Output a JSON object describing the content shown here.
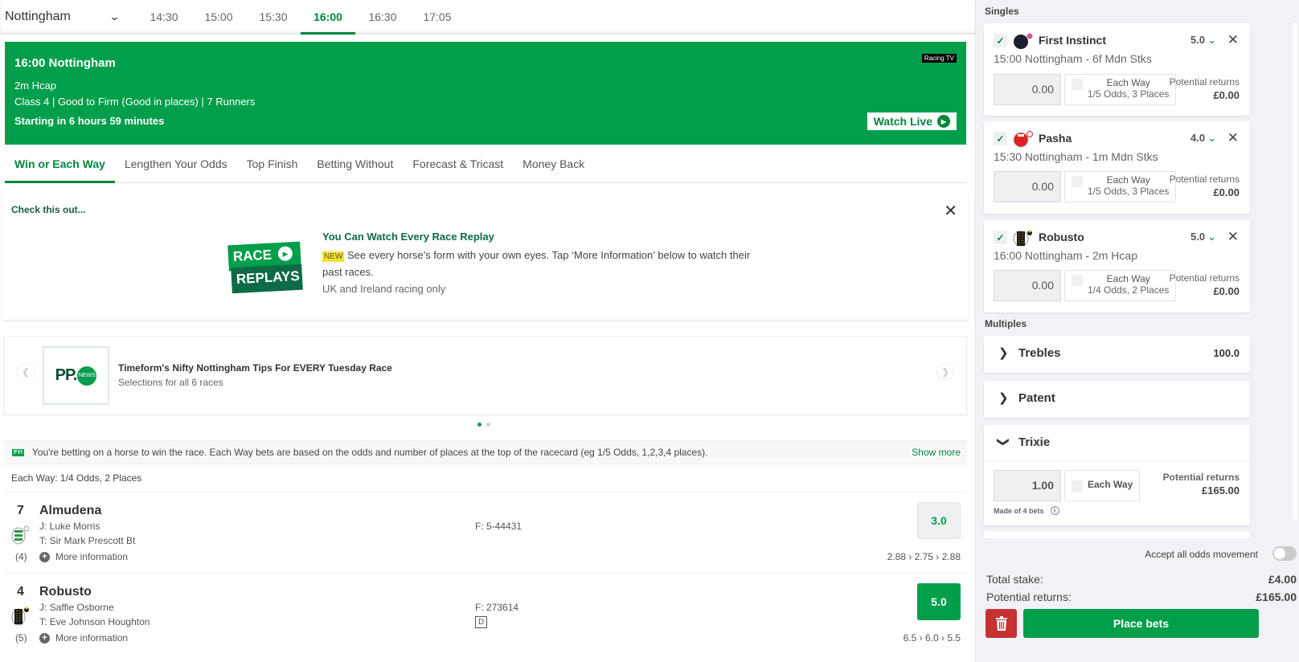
{
  "topbar": {
    "venue": "Nottingham",
    "times": [
      "14:30",
      "15:00",
      "15:30",
      "16:00",
      "16:30",
      "17:05"
    ],
    "active_time": "16:00"
  },
  "race_banner": {
    "title": "16:00 Nottingham",
    "race_type": "2m Hcap",
    "details": "Class 4 | Good to Firm (Good in places) | 7 Runners",
    "countdown": "Starting in 6 hours 59 minutes",
    "broadcaster": "Racing TV",
    "watch_live": "Watch Live"
  },
  "tabs": [
    "Win or Each Way",
    "Lengthen Your Odds",
    "Top Finish",
    "Betting Without",
    "Forecast & Tricast",
    "Money Back"
  ],
  "promo": {
    "header": "Check this out...",
    "logo_line1": "RACE",
    "logo_line2": "REPLAYS",
    "title": "You Can Watch Every Race Replay",
    "badge": "NEW",
    "text": "See every horse’s form with your own eyes. Tap ‘More Information’ below to watch their past races.",
    "subtext": "UK and Ireland racing only"
  },
  "news": {
    "logo_text": "PP.",
    "logo_badge": "NEWS",
    "title": "Timeform's Nifty Nottingham Tips For EVERY Tuesday Race",
    "subtitle": "Selections for all 6 races"
  },
  "fyi": {
    "badge": "FYI",
    "text": "You're betting on a horse to win the race. Each Way bets are based on the odds and number of places at the top of the racecard (eg 1/5 Odds, 1,2,3,4 places).",
    "show_more": "Show more"
  },
  "each_way_terms": "Each Way: 1/4 Odds, 2 Places",
  "runners": [
    {
      "number": "7",
      "name": "Almudena",
      "jockey": "J: Luke Morris",
      "trainer": "T: Sir Mark Prescott Bt",
      "draw": "(4)",
      "more": "More information",
      "form": "F: 5-44431",
      "badge": "",
      "odds": "3.0",
      "selected": false,
      "history": "2.88 › 2.75 › 2.88"
    },
    {
      "number": "4",
      "name": "Robusto",
      "jockey": "J: Saffie Osborne",
      "trainer": "T: Eve Johnson Houghton",
      "draw": "(5)",
      "more": "More information",
      "form": "F: 273614",
      "badge": "D",
      "odds": "5.0",
      "selected": true,
      "history": "6.5 › 6.0 › 5.5"
    }
  ],
  "betslip": {
    "singles_label": "Singles",
    "singles": [
      {
        "horse": "First Instinct",
        "price": "5.0",
        "race": "15:00 Nottingham - 6f Mdn Stks",
        "stake": "0.00",
        "each_way": "Each Way",
        "terms": "1/5 Odds, 3 Places",
        "returns_label": "Potential returns",
        "returns": "£0.00"
      },
      {
        "horse": "Pasha",
        "price": "4.0",
        "race": "15:30 Nottingham - 1m Mdn Stks",
        "stake": "0.00",
        "each_way": "Each Way",
        "terms": "1/5 Odds, 3 Places",
        "returns_label": "Potential returns",
        "returns": "£0.00"
      },
      {
        "horse": "Robusto",
        "price": "5.0",
        "race": "16:00 Nottingham - 2m Hcap",
        "stake": "0.00",
        "each_way": "Each Way",
        "terms": "1/4 Odds, 2 Places",
        "returns_label": "Potential returns",
        "returns": "£0.00"
      }
    ],
    "multiples_label": "Multiples",
    "multiples": [
      {
        "name": "Trebles",
        "value": "100.0"
      },
      {
        "name": "Patent",
        "value": ""
      },
      {
        "name": "Trixie",
        "value": "",
        "stake": "1.00",
        "each_way": "Each Way",
        "returns_label": "Potential returns",
        "returns": "£165.00",
        "made_of": "Made of 4 bets"
      }
    ],
    "accept_odds": "Accept all odds movement",
    "accept_odds_on": false,
    "total_stake_label": "Total stake:",
    "total_stake": "£4.00",
    "potential_returns_label": "Potential returns:",
    "potential_returns": "£165.00",
    "place_bets": "Place bets"
  }
}
